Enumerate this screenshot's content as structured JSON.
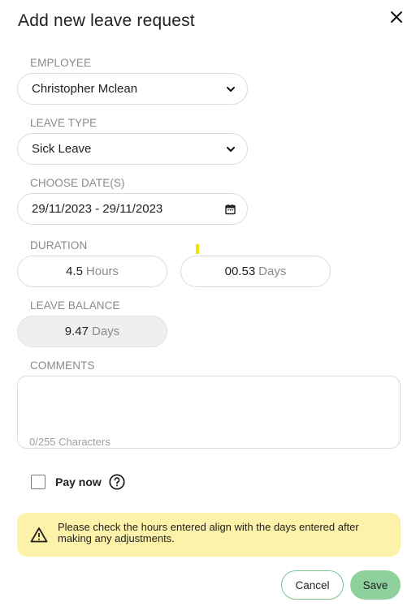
{
  "dialog": {
    "title": "Add new leave request",
    "close_icon": "close-icon"
  },
  "employee": {
    "label": "EMPLOYEE",
    "value": "Christopher Mclean"
  },
  "leave_type": {
    "label": "LEAVE TYPE",
    "value": "Sick Leave"
  },
  "dates": {
    "label": "CHOOSE DATE(S)",
    "value": "29/11/2023 - 29/11/2023"
  },
  "duration": {
    "label": "DURATION",
    "hours_value": "4.5",
    "hours_unit": "Hours",
    "days_value": "00.53",
    "days_unit": "Days"
  },
  "leave_balance": {
    "label": "LEAVE BALANCE",
    "value": "9.47",
    "unit": "Days"
  },
  "comments": {
    "label": "COMMENTS",
    "value": "",
    "counter": "0/255 Characters"
  },
  "pay_now": {
    "label": "Pay now",
    "checked": false
  },
  "alert": {
    "message": "Please check the hours entered align with the days entered after making any adjustments."
  },
  "actions": {
    "cancel_label": "Cancel",
    "save_label": "Save"
  },
  "colors": {
    "accent_green": "#8fd19c",
    "cancel_border": "#7cc48c",
    "alert_bg": "#fdf2a9"
  }
}
